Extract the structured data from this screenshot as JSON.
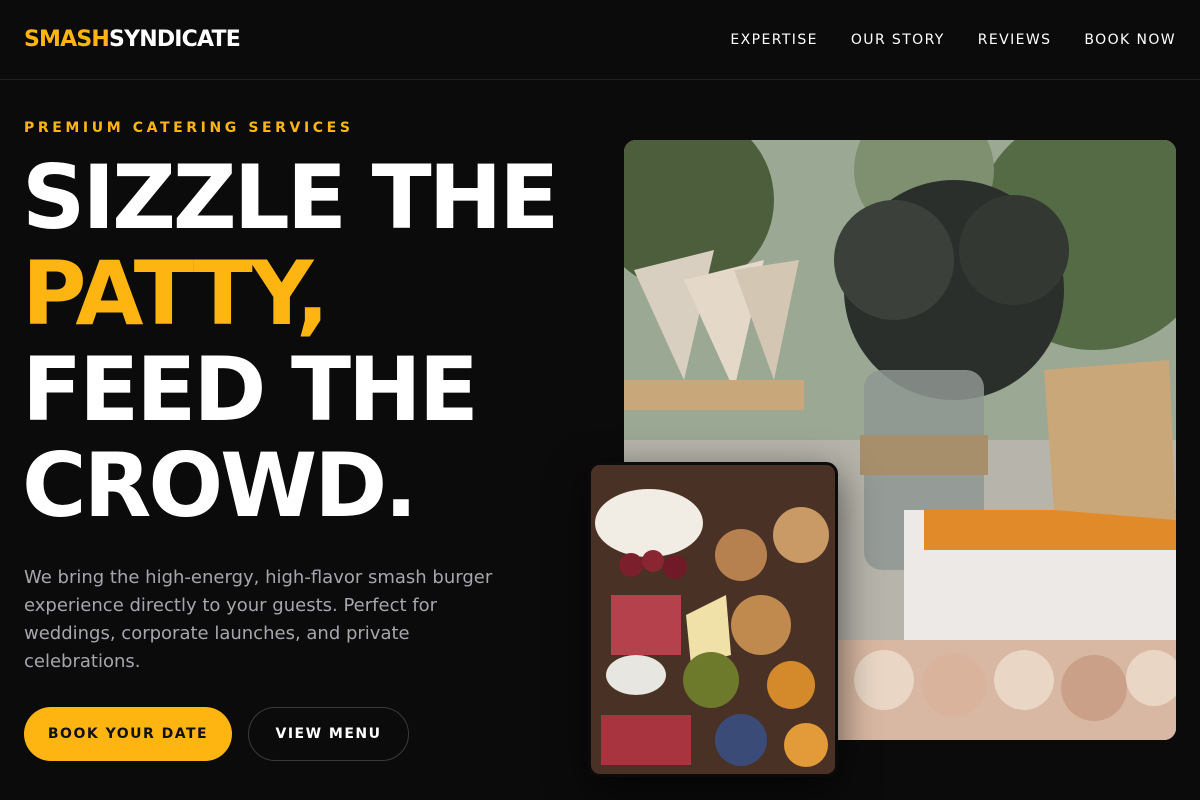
{
  "brand": {
    "part1": "SMASH",
    "part2": "SYNDICATE",
    "accent_color": "#ffb511"
  },
  "nav": {
    "items": [
      "EXPERTISE",
      "OUR STORY",
      "REVIEWS",
      "BOOK NOW"
    ]
  },
  "hero": {
    "eyebrow": "PREMIUM CATERING SERVICES",
    "headline": {
      "line1": "SIZZLE THE",
      "line2": "PATTY,",
      "line3": "FEED THE",
      "line4": "CROWD."
    },
    "description": "We bring the high-energy, high-flavor smash burger experience directly to your guests. Perfect for weddings, corporate launches, and private celebrations.",
    "primary_cta": "BOOK YOUR DATE",
    "secondary_cta": "VIEW MENU"
  },
  "images": {
    "main": "outdoor-catering-table-photo",
    "inset": "charcuterie-board-photo"
  }
}
